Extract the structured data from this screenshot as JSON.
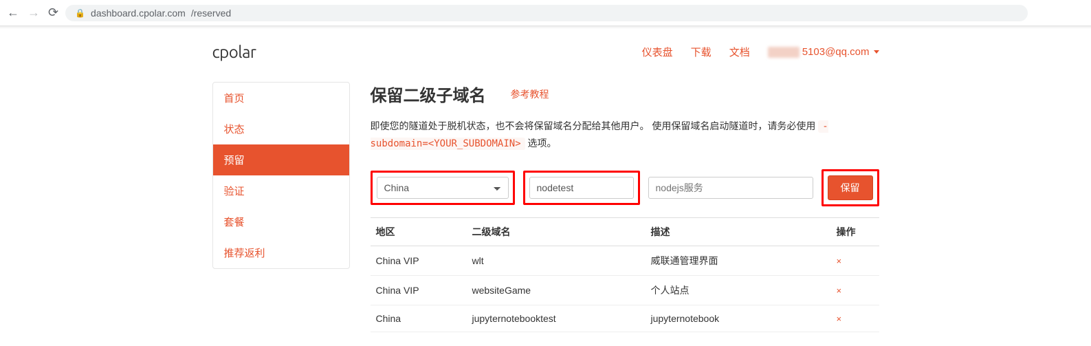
{
  "browser": {
    "url_host": "dashboard.cpolar.com",
    "url_path": "/reserved"
  },
  "header": {
    "logo": "cpolar",
    "nav": {
      "dashboard": "仪表盘",
      "download": "下载",
      "docs": "文档",
      "email_suffix": "5103@qq.com"
    }
  },
  "sidebar": {
    "items": [
      {
        "label": "首页",
        "active": false
      },
      {
        "label": "状态",
        "active": false
      },
      {
        "label": "预留",
        "active": true
      },
      {
        "label": "验证",
        "active": false
      },
      {
        "label": "套餐",
        "active": false
      },
      {
        "label": "推荐返利",
        "active": false
      }
    ]
  },
  "main": {
    "title": "保留二级子域名",
    "reference_link": "参考教程",
    "description_pre": "即使您的隧道处于脱机状态，也不会将保留域名分配给其他用户。 使用保留域名启动隧道时，请务必使用 ",
    "description_code": "-subdomain=<YOUR_SUBDOMAIN>",
    "description_post": " 选项。",
    "form": {
      "region_value": "China",
      "subdomain_value": "nodetest",
      "desc_placeholder": "nodejs服务",
      "reserve_button": "保留"
    },
    "table": {
      "headers": {
        "region": "地区",
        "subdomain": "二级域名",
        "desc": "描述",
        "action": "操作"
      },
      "rows": [
        {
          "region": "China VIP",
          "subdomain": "wlt",
          "desc": "威联通管理界面"
        },
        {
          "region": "China VIP",
          "subdomain": "websiteGame",
          "desc": "个人站点"
        },
        {
          "region": "China",
          "subdomain": "jupyternotebooktest",
          "desc": "jupyternotebook"
        }
      ],
      "delete_glyph": "×"
    }
  }
}
